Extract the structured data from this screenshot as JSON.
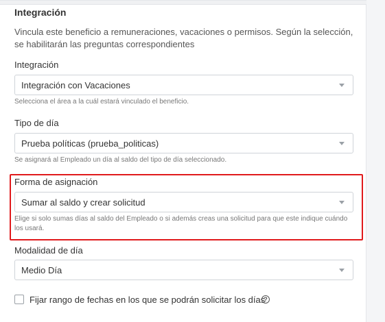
{
  "section": {
    "title": "Integración",
    "description": "Vincula este beneficio a remuneraciones, vacaciones o permisos. Según la selección, se habilitarán las preguntas correspondientes"
  },
  "fields": [
    {
      "label": "Integración",
      "value": "Integración con Vacaciones",
      "help": "Selecciona el área a la cuál estará vinculado el beneficio."
    },
    {
      "label": "Tipo de día",
      "value": "Prueba políticas (prueba_politicas)",
      "help": "Se asignará al Empleado un día al saldo del tipo de día seleccionado."
    },
    {
      "label": "Forma de asignación",
      "value": "Sumar al saldo y crear solicitud",
      "help": "Elige si solo sumas días al saldo del Empleado o si además creas una solicitud para que este indique cuándo los usará."
    },
    {
      "label": "Modalidad de día",
      "value": "Medio Día"
    }
  ],
  "checkbox": {
    "label": "Fijar rango de fechas en los que se podrán solicitar los días",
    "checked": false,
    "help_icon": "question-circle-icon"
  },
  "colors": {
    "highlight": "#e0191b",
    "border": "#cfd3d8"
  }
}
